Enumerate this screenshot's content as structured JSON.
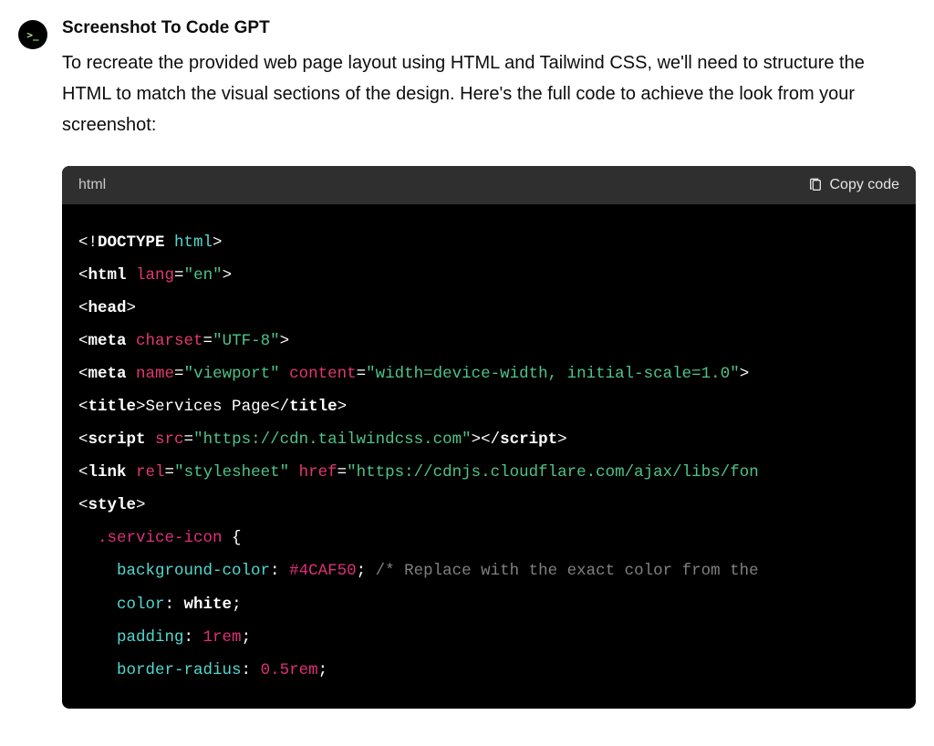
{
  "author": {
    "name": "Screenshot To Code GPT",
    "avatar_text": ">_"
  },
  "message": {
    "text": "To recreate the provided web page layout using HTML and Tailwind CSS, we'll need to structure the HTML to match the visual sections of the design. Here's the full code to achieve the look from your screenshot:"
  },
  "code_block": {
    "language": "html",
    "copy_label": "Copy code",
    "tokens": {
      "l1_a": "<!",
      "l1_b": "DOCTYPE",
      "l1_c": " html",
      "l1_d": ">",
      "l2_a": "<",
      "l2_b": "html",
      "l2_c": " lang",
      "l2_d": "=",
      "l2_e": "\"en\"",
      "l2_f": ">",
      "l3_a": "<",
      "l3_b": "head",
      "l3_c": ">",
      "l4_a": "<",
      "l4_b": "meta",
      "l4_c": " charset",
      "l4_d": "=",
      "l4_e": "\"UTF-8\"",
      "l4_f": ">",
      "l5_a": "<",
      "l5_b": "meta",
      "l5_c": " name",
      "l5_d": "=",
      "l5_e": "\"viewport\"",
      "l5_f": " content",
      "l5_g": "=",
      "l5_h": "\"width=device-width, initial-scale=1.0\"",
      "l5_i": ">",
      "l6_a": "<",
      "l6_b": "title",
      "l6_c": ">",
      "l6_d": "Services Page",
      "l6_e": "</",
      "l6_f": "title",
      "l6_g": ">",
      "l7_a": "<",
      "l7_b": "script",
      "l7_c": " src",
      "l7_d": "=",
      "l7_e": "\"https://cdn.tailwindcss.com\"",
      "l7_f": ">",
      "l7_g": "</",
      "l7_h": "script",
      "l7_i": ">",
      "l8_a": "<",
      "l8_b": "link",
      "l8_c": " rel",
      "l8_d": "=",
      "l8_e": "\"stylesheet\"",
      "l8_f": " href",
      "l8_g": "=",
      "l8_h": "\"https://cdnjs.cloudflare.com/ajax/libs/fon",
      "l9_a": "<",
      "l9_b": "style",
      "l9_c": ">",
      "l10_a": "  ",
      "l10_b": ".service-icon",
      "l10_c": " {",
      "l11_a": "    ",
      "l11_b": "background-color",
      "l11_c": ": ",
      "l11_d": "#4CAF50",
      "l11_e": ";",
      "l11_f": " /* Replace with the exact color from the",
      "l12_a": "    ",
      "l12_b": "color",
      "l12_c": ": ",
      "l12_d": "white",
      "l12_e": ";",
      "l13_a": "    ",
      "l13_b": "padding",
      "l13_c": ": ",
      "l13_d": "1rem",
      "l13_e": ";",
      "l14_a": "    ",
      "l14_b": "border-radius",
      "l14_c": ": ",
      "l14_d": "0.5rem",
      "l14_e": ";"
    }
  }
}
